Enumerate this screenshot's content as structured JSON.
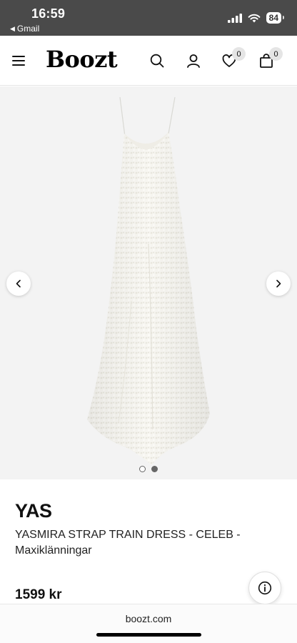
{
  "status_bar": {
    "time": "16:59",
    "back_app": "Gmail",
    "battery": "84"
  },
  "header": {
    "logo": "Boozt",
    "wishlist_count": "0",
    "cart_count": "0"
  },
  "gallery": {
    "image_count": 2,
    "active_index": 1
  },
  "product": {
    "brand": "YAS",
    "name": "YASMIRA STRAP TRAIN DRESS - CELEB - Maxiklänningar",
    "price": "1599 kr"
  },
  "browser": {
    "url": "boozt.com"
  },
  "icons": {
    "menu": "hamburger-icon",
    "search": "search-icon",
    "account": "user-icon",
    "wishlist": "heart-icon",
    "cart": "bag-icon",
    "info": "info-icon"
  }
}
